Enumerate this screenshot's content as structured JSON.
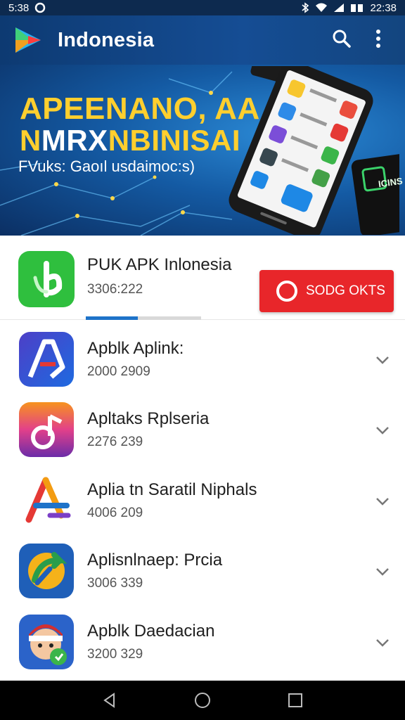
{
  "status_bar": {
    "time": "5:38",
    "notification_icon": "circle-notification-icon",
    "clock_right": "22:38",
    "icons": [
      "bluetooth-icon",
      "wifi-icon",
      "signal-icon",
      "battery-icon"
    ]
  },
  "app_bar": {
    "title": "Indonesia",
    "logo_icon": "play-logo-icon",
    "actions": [
      "search-icon",
      "more-vert-icon"
    ]
  },
  "banner": {
    "headline_line1": "APEENANO, AA",
    "headline_line2_a": "N",
    "headline_line2_b": "MRX",
    "headline_line2_c": "NBINISAI",
    "subtitle": "FVuks: Gaoıl usdaimoc:s)",
    "phone_corner_label": "ICINS"
  },
  "featured": {
    "name": "PUK APK Inlonesia",
    "size": "3306:222",
    "button_label": "SODG OKTS",
    "download_progress": 0.45,
    "icon": "green-leaf-app-icon"
  },
  "apps": [
    {
      "name": "Apblk Aplink:",
      "size": "2000 2909",
      "icon": "letter-a-app-icon"
    },
    {
      "name": "Apltaks Rplseria",
      "size": "2276 239",
      "icon": "music-note-app-icon"
    },
    {
      "name": "Aplia tn Saratil Niphals",
      "size": "4006 209",
      "icon": "colorful-a-app-icon"
    },
    {
      "name": "Aplisnlnaep: Prcia",
      "size": "3006 339",
      "icon": "refresh-arrow-app-icon"
    },
    {
      "name": "Apblk Daedacian",
      "size": "3200 329",
      "icon": "avatar-character-app-icon"
    }
  ],
  "nav_bar": [
    "back-icon",
    "home-icon",
    "recents-icon"
  ],
  "colors": {
    "app_bar": "#154d94",
    "accent_red": "#e8262a",
    "progress_blue": "#1e73c9",
    "headline_yellow": "#ffcf2e"
  }
}
